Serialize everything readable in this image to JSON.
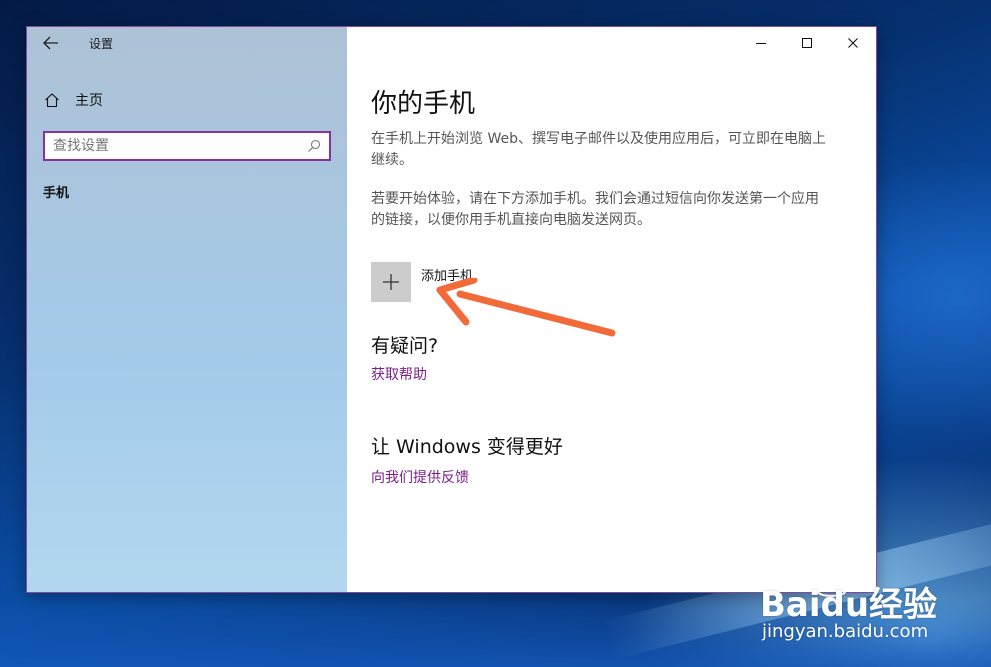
{
  "window": {
    "title": "设置"
  },
  "sidebar": {
    "home_label": "主页",
    "search_placeholder": "查找设置",
    "section_label": "手机"
  },
  "main": {
    "title": "你的手机",
    "para1": "在手机上开始浏览 Web、撰写电子邮件以及使用应用后，可立即在电脑上继续。",
    "para2": "若要开始体验，请在下方添加手机。我们会通过短信向你发送第一个应用的链接，以便你用手机直接向电脑发送网页。",
    "add_phone_label": "添加手机",
    "questions_heading": "有疑问?",
    "help_link": "获取帮助",
    "better_heading": "让 Windows 变得更好",
    "feedback_link": "向我们提供反馈"
  },
  "watermark": {
    "brand": "Baidu经验",
    "url": "jingyan.baidu.com"
  },
  "colors": {
    "accent_border": "#8b2f9b",
    "link": "#7b1f8a",
    "annotation_arrow": "#f26a3a"
  },
  "icons": {
    "back": "back-arrow-icon",
    "home": "home-icon",
    "search": "search-icon",
    "minimize": "minimize-icon",
    "maximize": "maximize-icon",
    "close": "close-icon",
    "add": "plus-icon"
  }
}
